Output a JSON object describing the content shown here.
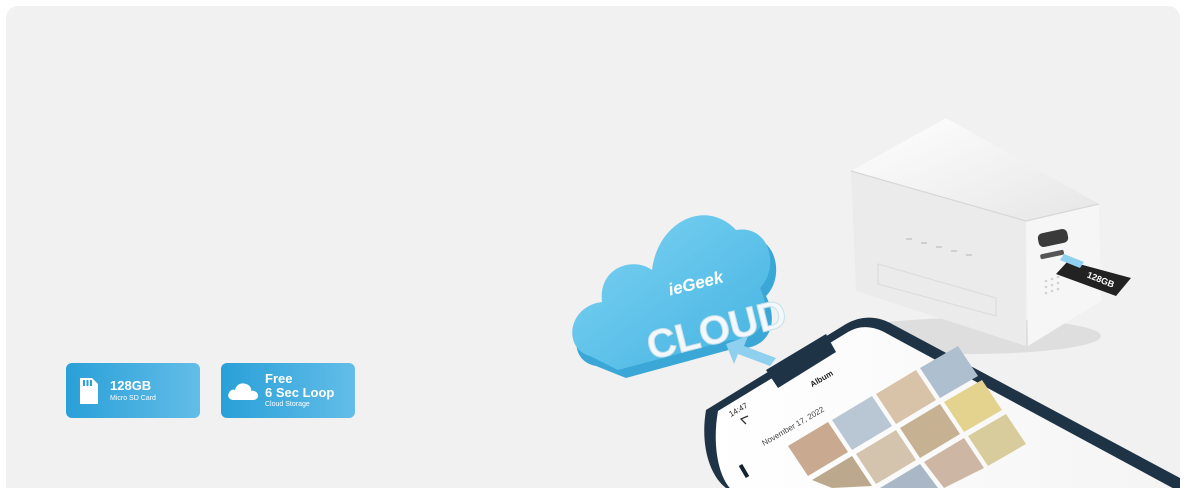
{
  "badges": [
    {
      "icon": "sd-card-icon",
      "title_line1": "128GB",
      "subtitle": "Micro SD Card"
    },
    {
      "icon": "cloud-icon",
      "title_line1": "Free",
      "title_line2": "6 Sec Loop",
      "subtitle": "Cloud Storage"
    }
  ],
  "cloud": {
    "brand": "ieGeek",
    "word": "CLOUD"
  },
  "sd_card": {
    "label": "128GB"
  },
  "phone": {
    "time": "14:47",
    "title": "Album",
    "date": "November 17, 2022"
  },
  "colors": {
    "badge_start": "#29a0d8",
    "badge_end": "#63bde8",
    "cloud": "#5cc4ea",
    "background": "#f1f1f1"
  }
}
